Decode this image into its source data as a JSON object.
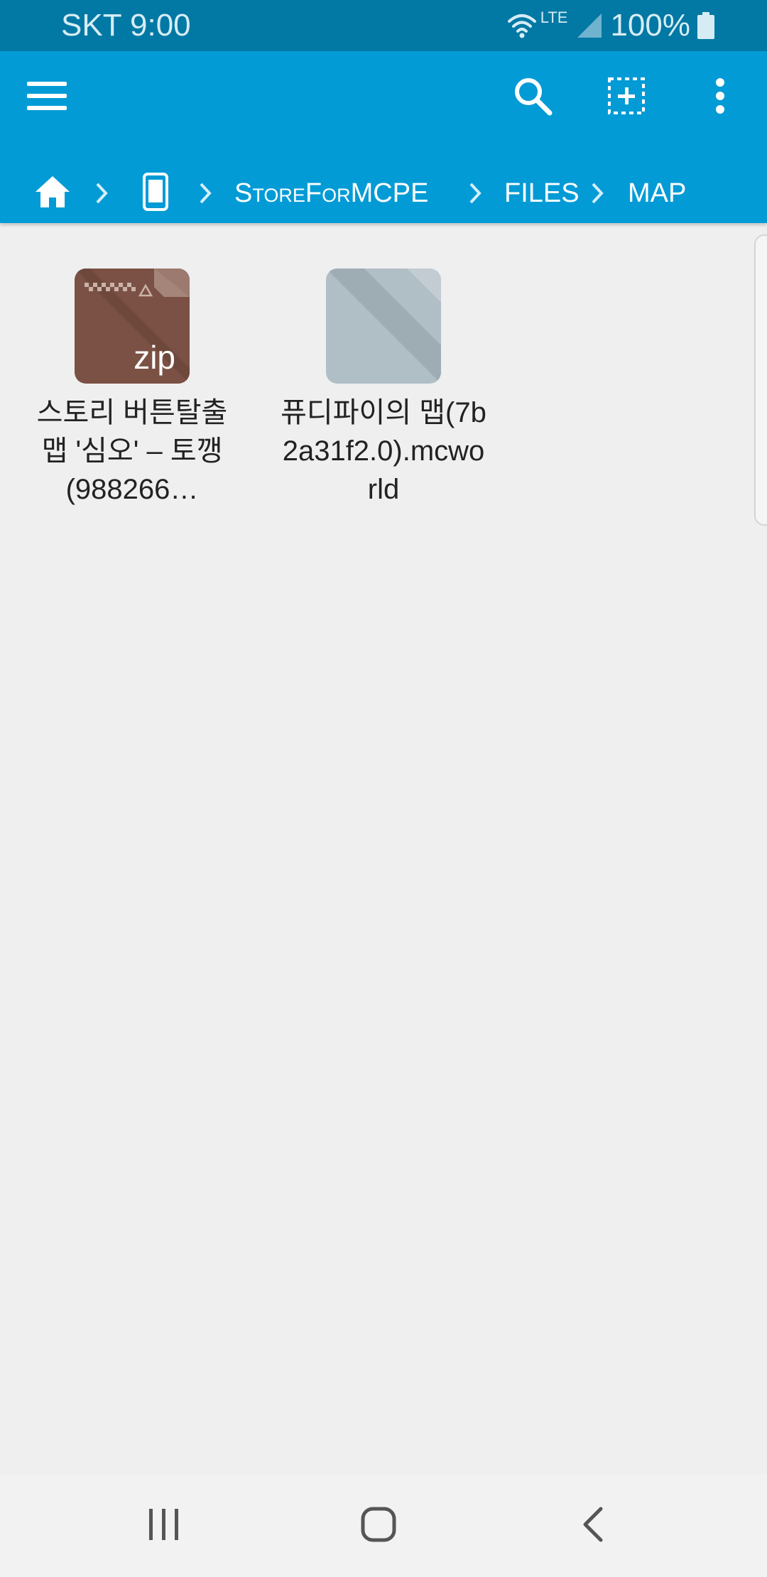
{
  "status_bar": {
    "carrier_time": "SKT 9:00",
    "network_type": "LTE",
    "battery": "100%",
    "icons": [
      "wifi-icon",
      "signal-icon",
      "battery-icon"
    ]
  },
  "toolbar": {
    "icons": [
      "menu-icon",
      "search-icon",
      "select-all-icon",
      "more-options-icon"
    ]
  },
  "breadcrumb": {
    "items": [
      {
        "type": "icon",
        "name": "home-icon"
      },
      {
        "type": "icon",
        "name": "phone-storage-icon"
      },
      {
        "type": "text",
        "label": "StoreForMCPE"
      },
      {
        "type": "text",
        "label": "FILES"
      },
      {
        "type": "text",
        "label": "MAP"
      }
    ]
  },
  "files": [
    {
      "name": "스토리 버튼탈출맵 '심오' – 토깽(988266…",
      "thumb_label": "zip",
      "icon": "zip-file-icon"
    },
    {
      "name": "퓨디파이의 맵(7b2a31f2.0).mcworld",
      "icon": "generic-file-icon"
    }
  ],
  "navigation_bar": {
    "icons": [
      "recent-apps-icon",
      "home-button-icon",
      "back-icon"
    ]
  },
  "colors": {
    "status_bar": "#0278a4",
    "app_bar": "#039bd6",
    "background": "#efefef",
    "zip_thumb": "#7a5144",
    "generic_thumb": "#b0bec5"
  }
}
